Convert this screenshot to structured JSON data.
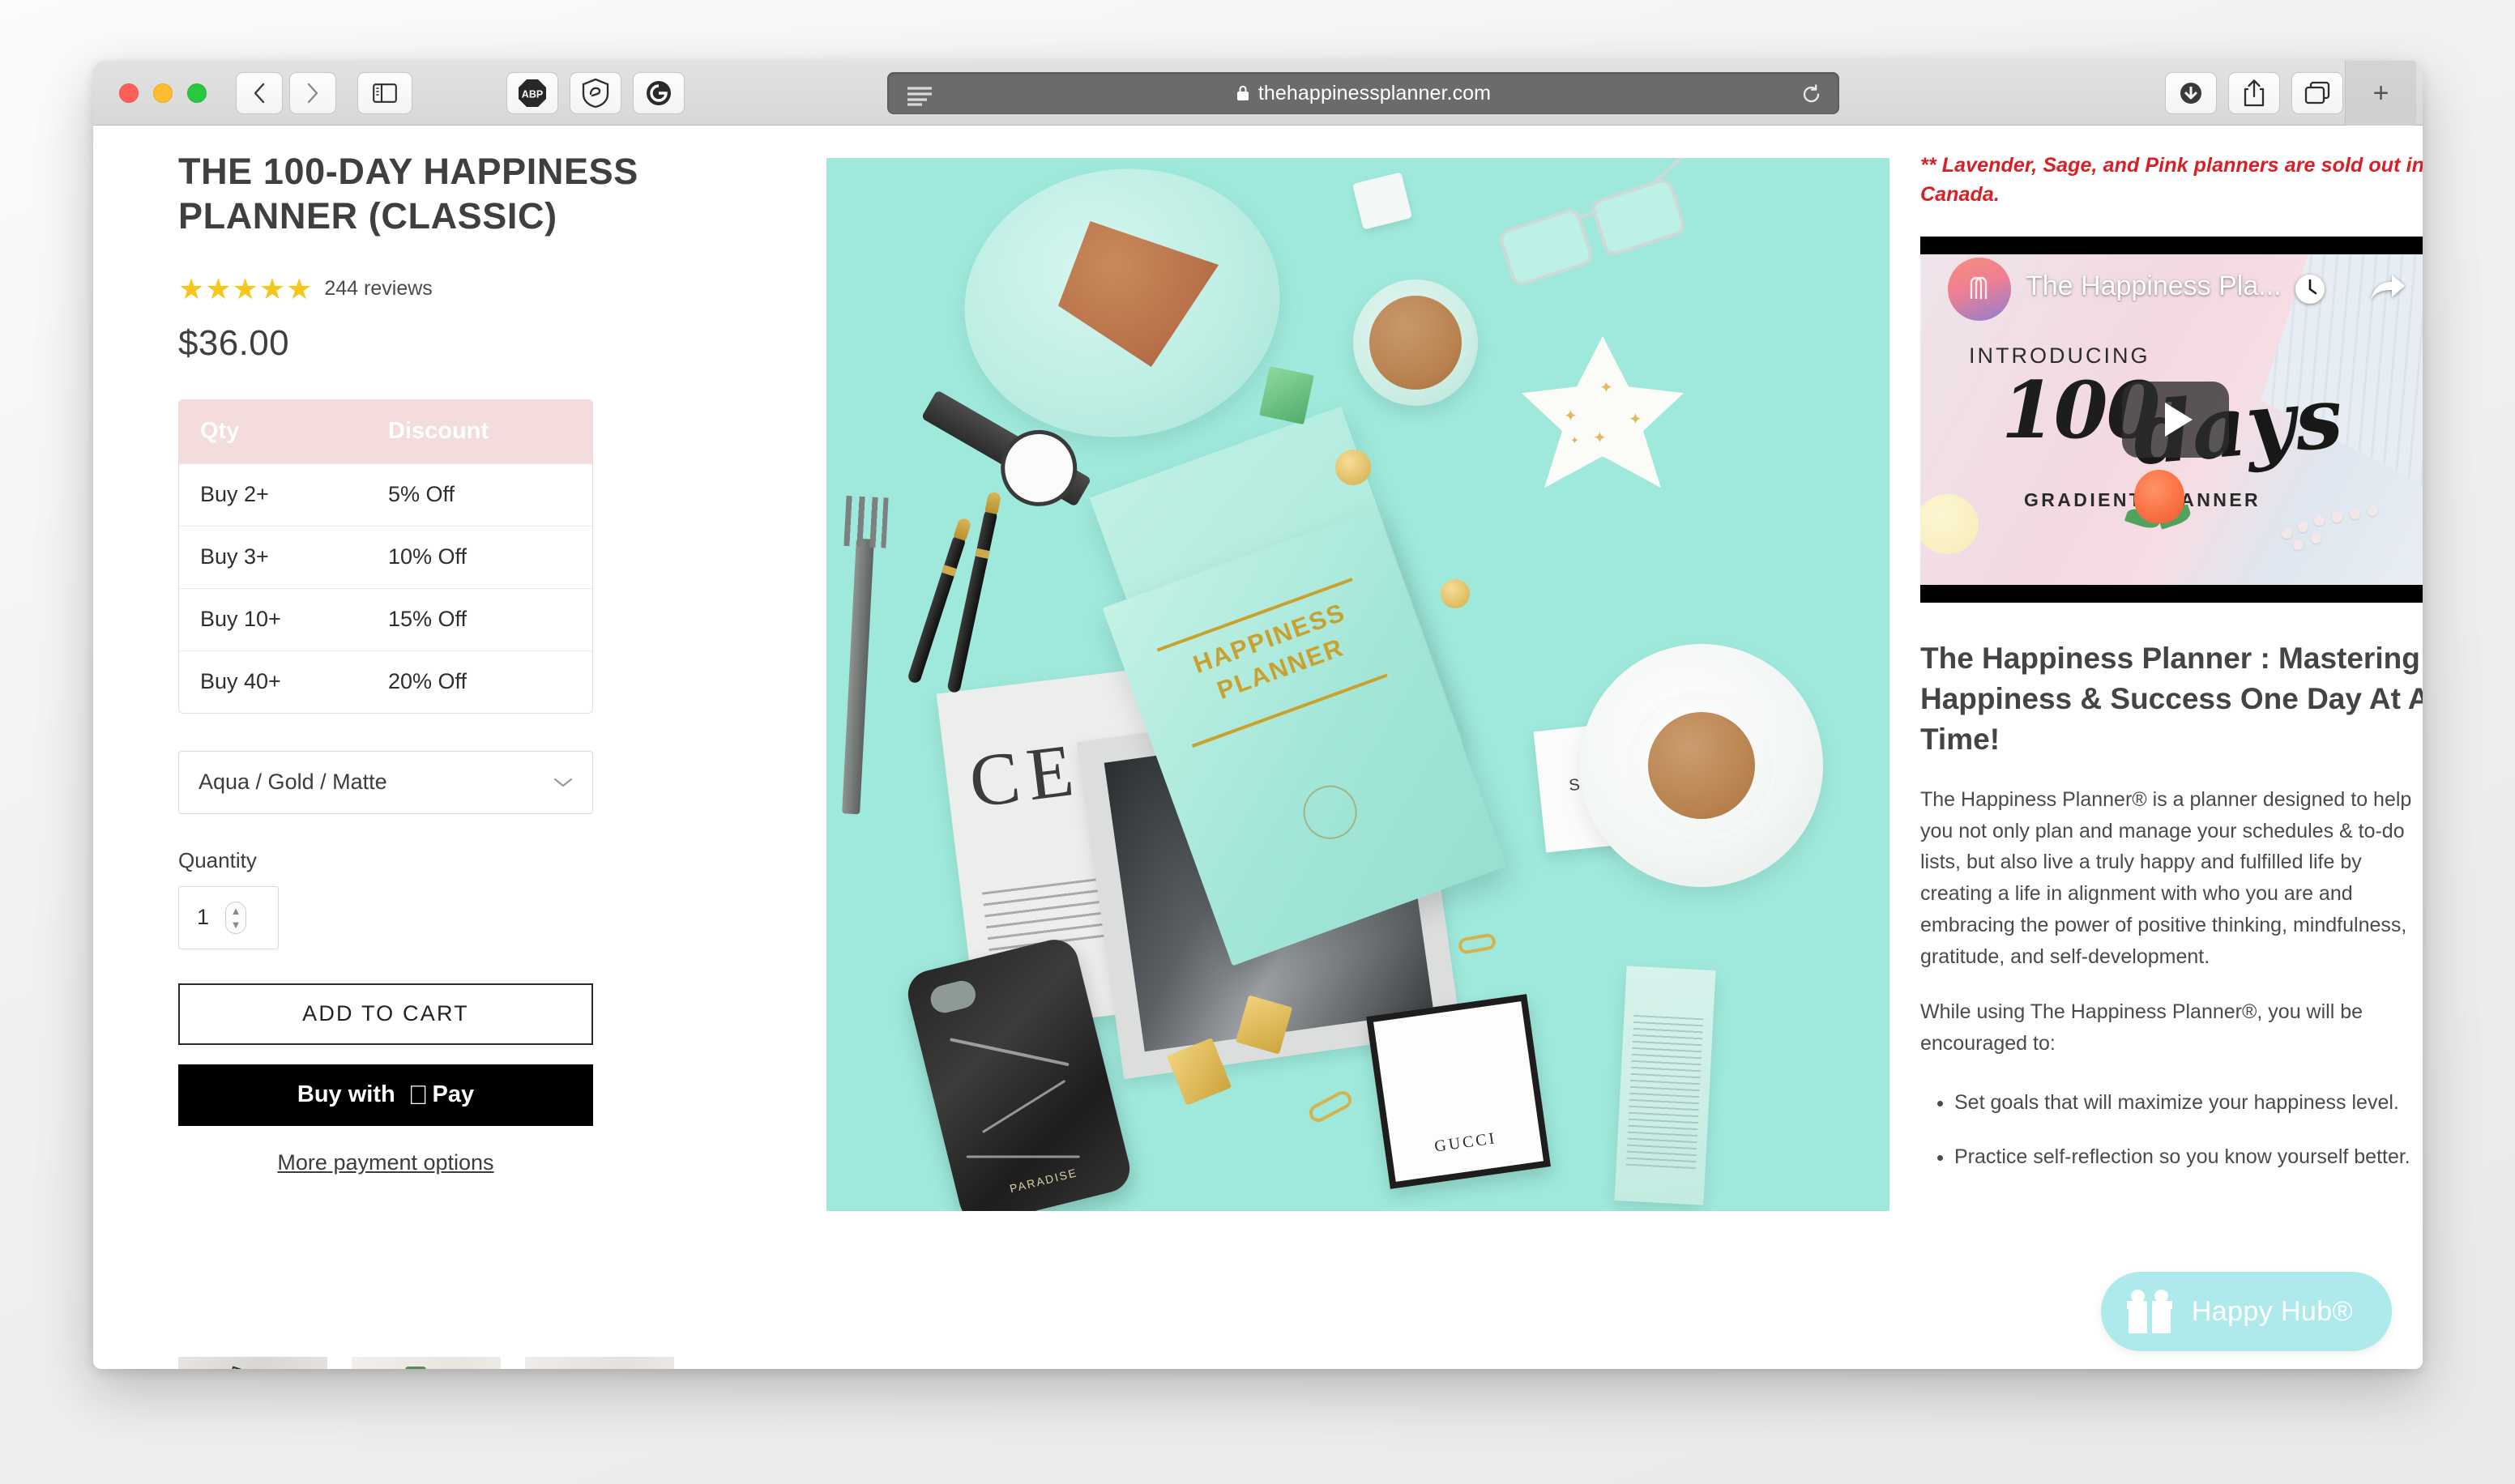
{
  "browser": {
    "url": "thehappinessplanner.com",
    "lock_icon": "lock-icon",
    "traffic_lights": [
      "close",
      "minimize",
      "zoom"
    ],
    "back_label": "‹",
    "forward_label": "›",
    "sidebar_icon": "sidebar-icon",
    "extensions": [
      {
        "name": "adblock-plus",
        "label": "ABP"
      },
      {
        "name": "ghostery-shield",
        "label": ""
      },
      {
        "name": "grammarly",
        "label": "G"
      }
    ],
    "reader_icon": "reader-view-icon",
    "reload_icon": "reload-icon",
    "downloads_icon": "downloads-icon",
    "share_icon": "share-icon",
    "tab-overview_icon": "tab-overview-icon",
    "new_tab_label": "+"
  },
  "product": {
    "title": "THE 100-DAY HAPPINESS PLANNER (CLASSIC)",
    "stars": "★★★★★",
    "reviews": "244 reviews",
    "price": "$36.00",
    "discount_table": {
      "headers": [
        "Qty",
        "Discount"
      ],
      "rows": [
        [
          "Buy 2+",
          "5% Off"
        ],
        [
          "Buy 3+",
          "10% Off"
        ],
        [
          "Buy 10+",
          "15% Off"
        ],
        [
          "Buy 40+",
          "20% Off"
        ]
      ]
    },
    "variant_selected": "Aqua / Gold / Matte",
    "quantity_label": "Quantity",
    "quantity_value": "1",
    "add_to_cart_label": "ADD TO CART",
    "apple_pay_label": "Buy with",
    "apple_pay_mark": "Pay",
    "more_payment_label": "More payment options"
  },
  "hero": {
    "planner_line1": "HAPPINESS",
    "planner_line2": "PLANNER",
    "magazine_text": "CE",
    "sacet_text": "SACET",
    "gucci_text": "GUCCI",
    "phone_brand": "PARADISE",
    "background_color": "#9ee9dc"
  },
  "right": {
    "sold_out_note": "** Lavender, Sage, and Pink planners are sold out in Canada.",
    "video": {
      "title": "The Happiness Pla...",
      "introducing": "INTRODUCING",
      "hundred": "100",
      "days": "days",
      "sub": "GRADIENT PLANNER",
      "clock_icon": "watch-later-icon",
      "share_icon": "share-icon",
      "play_icon": "play-icon"
    },
    "heading": "The Happiness Planner : Mastering Happiness & Success One Day At A Time!",
    "paragraph1": "The Happiness Planner® is a planner designed to help you not only plan and manage your schedules & to-do lists, but also live a truly happy and fulfilled life by creating a life in alignment with who you are and embracing the power of positive thinking, mindfulness, gratitude, and self-development.",
    "paragraph2": "While using The Happiness Planner®, you will be encouraged to:",
    "bullets": [
      "Set goals that will maximize your happiness level.",
      "Practice self-reflection so you know yourself better."
    ]
  },
  "widget": {
    "label": "Happy Hub®",
    "icon": "gift-icon",
    "color": "#aeeaeb"
  },
  "thumbnails": [
    {
      "name": "thumbnail-1"
    },
    {
      "name": "thumbnail-2"
    },
    {
      "name": "thumbnail-3"
    }
  ]
}
